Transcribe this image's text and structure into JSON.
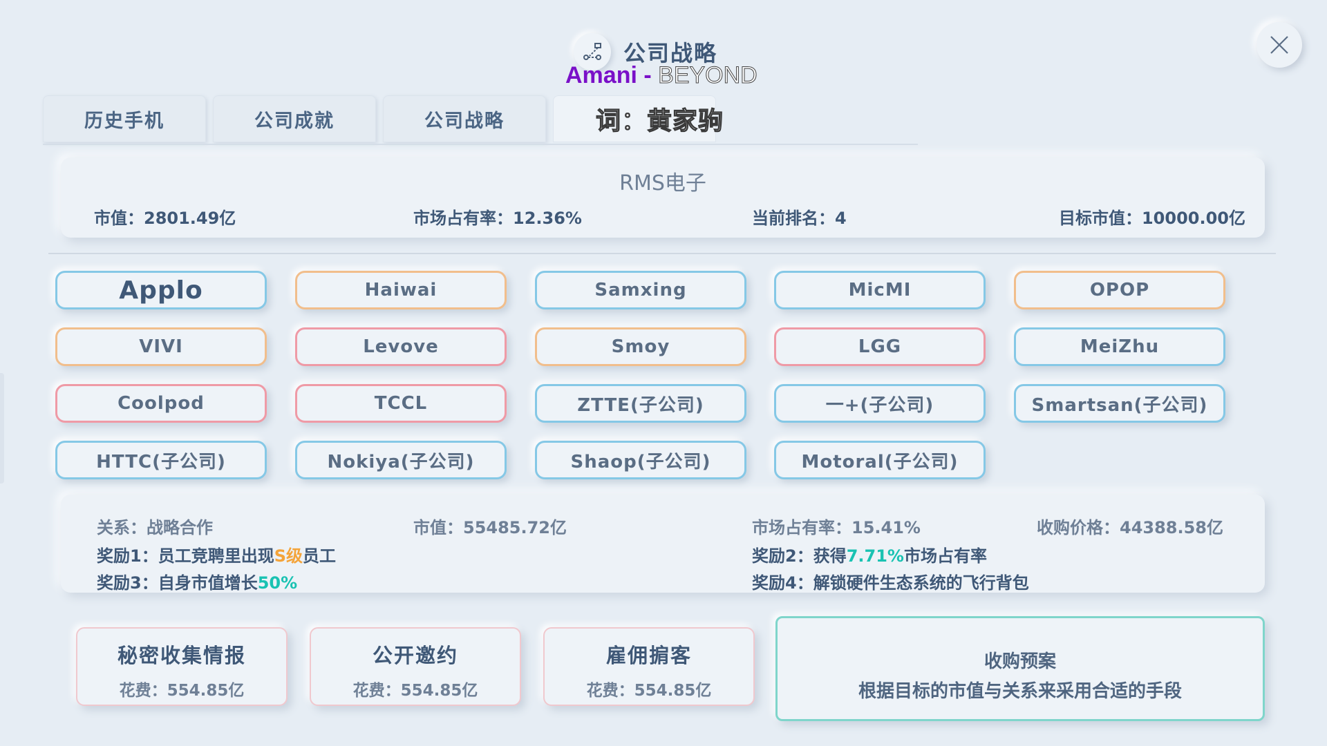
{
  "header": {
    "title": "公司战略",
    "icon": "strategy-route-icon"
  },
  "subtitle": {
    "artist": "Amani",
    "separator": " - ",
    "song": "BEYOND",
    "lyric": "词：黄家驹"
  },
  "tabs": [
    {
      "label": "历史手机"
    },
    {
      "label": "公司成就"
    },
    {
      "label": "公司战略"
    },
    {
      "label": ""
    }
  ],
  "company": {
    "name": "RMS电子",
    "market_value": "市值：2801.49亿",
    "market_share": "市场占有率：12.36%",
    "rank": "当前排名：4",
    "target_value": "目标市值：10000.00亿"
  },
  "competitors": [
    {
      "label": "Applo",
      "border": "blue",
      "selected": true
    },
    {
      "label": "Haiwai",
      "border": "orange"
    },
    {
      "label": "Samxing",
      "border": "blue"
    },
    {
      "label": "MicMI",
      "border": "blue"
    },
    {
      "label": "OPOP",
      "border": "orange"
    },
    {
      "label": "VIVI",
      "border": "orange"
    },
    {
      "label": "Levove",
      "border": "red"
    },
    {
      "label": "Smoy",
      "border": "orange"
    },
    {
      "label": "LGG",
      "border": "red"
    },
    {
      "label": "MeiZhu",
      "border": "blue"
    },
    {
      "label": "Coolpod",
      "border": "red"
    },
    {
      "label": "TCCL",
      "border": "red"
    },
    {
      "label": "ZTTE(子公司)",
      "border": "blue"
    },
    {
      "label": "一+(子公司)",
      "border": "blue"
    },
    {
      "label": "Smartsan(子公司)",
      "border": "blue"
    },
    {
      "label": "HTTC(子公司)",
      "border": "blue"
    },
    {
      "label": "Nokiya(子公司)",
      "border": "blue"
    },
    {
      "label": "Shaop(子公司)",
      "border": "blue"
    },
    {
      "label": "Motoral(子公司)",
      "border": "blue"
    }
  ],
  "detail": {
    "relation": "关系：战略合作",
    "market_value": "市值：55485.72亿",
    "market_share": "市场占有率：15.41%",
    "acquire_price": "收购价格：44388.58亿",
    "reward1_prefix": "奖励1：员工竞聘里出现",
    "reward1_highlight": "S级",
    "reward1_suffix": "员工",
    "reward2_prefix": "奖励2：获得",
    "reward2_highlight": "7.71%",
    "reward2_suffix": "市场占有率",
    "reward3_prefix": "奖励3：自身市值增长",
    "reward3_highlight": "50%",
    "reward4": "奖励4：解锁硬件生态系统的飞行背包"
  },
  "actions": [
    {
      "title": "秘密收集情报",
      "cost": "花费：554.85亿"
    },
    {
      "title": "公开邀约",
      "cost": "花费：554.85亿"
    },
    {
      "title": "雇佣掮客",
      "cost": "花费：554.85亿"
    }
  ],
  "plan": {
    "title": "收购预案",
    "desc": "根据目标的市值与关系来采用合适的手段"
  },
  "colors": {
    "accent_orange": "#f4a43a",
    "accent_teal": "#19c2b2",
    "border_blue": "#85c8e6",
    "border_orange": "#f1be8c",
    "border_red": "#ef9aa6"
  }
}
